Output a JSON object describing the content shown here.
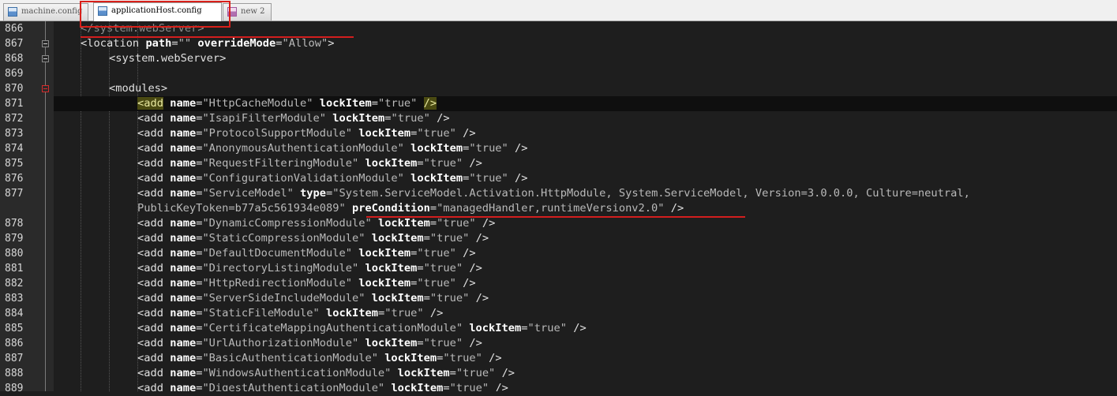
{
  "tabs": [
    {
      "label": "machine.config",
      "icon": "xml-file-icon"
    },
    {
      "label": "applicationHost.config",
      "icon": "xml-file-icon"
    },
    {
      "label": "new  2",
      "icon": "modified-file-icon"
    }
  ],
  "active_tab": "applicationHost.config",
  "current_line": 871,
  "colors": {
    "highlight_red": "#d31e1e",
    "editor_bg": "#1e1e1e"
  },
  "line_numbers": [
    "866",
    "867",
    "868",
    "869",
    "870",
    "871",
    "872",
    "873",
    "874",
    "875",
    "876",
    "877",
    "",
    "878",
    "879",
    "880",
    "881",
    "882",
    "883",
    "884",
    "885",
    "886",
    "887",
    "888",
    "889"
  ],
  "code": {
    "l866": "</system.webServer>",
    "l867": {
      "lt": "<",
      "tag": "location",
      "a1": "path",
      "v1": "\"\"",
      "a2": "overrideMode",
      "v2": "\"Allow\"",
      "gt": ">"
    },
    "l868": "<system.webServer>",
    "l870": "<modules>",
    "l871": {
      "tag": "<add",
      "a1": "name",
      "v1": "\"HttpCacheModule\"",
      "a2": "lockItem",
      "v2": "\"true\"",
      "close": "/>"
    },
    "adds": [
      {
        "name": "\"IsapiFilterModule\"",
        "lock": "\"true\""
      },
      {
        "name": "\"ProtocolSupportModule\"",
        "lock": "\"true\""
      },
      {
        "name": "\"AnonymousAuthenticationModule\"",
        "lock": "\"true\""
      },
      {
        "name": "\"RequestFilteringModule\"",
        "lock": "\"true\""
      },
      {
        "name": "\"ConfigurationValidationModule\"",
        "lock": "\"true\""
      }
    ],
    "l877": {
      "tag": "<add",
      "a1": "name",
      "v1": "\"ServiceModel\"",
      "a2": "type",
      "v2": "\"System.ServiceModel.Activation.HttpModule, System.ServiceModel, Version=3.0.0.0, Culture=neutral,",
      "v2b": "PublicKeyToken=b77a5c561934e089\"",
      "a3": "preCondition",
      "v3": "\"managedHandler,runtimeVersionv2.0\"",
      "close": "/>"
    },
    "adds2": [
      {
        "name": "\"DynamicCompressionModule\"",
        "lock": "\"true\""
      },
      {
        "name": "\"StaticCompressionModule\"",
        "lock": "\"true\""
      },
      {
        "name": "\"DefaultDocumentModule\"",
        "lock": "\"true\""
      },
      {
        "name": "\"DirectoryListingModule\"",
        "lock": "\"true\""
      },
      {
        "name": "\"HttpRedirectionModule\"",
        "lock": "\"true\""
      },
      {
        "name": "\"ServerSideIncludeModule\"",
        "lock": "\"true\""
      },
      {
        "name": "\"StaticFileModule\"",
        "lock": "\"true\""
      },
      {
        "name": "\"CertificateMappingAuthenticationModule\"",
        "lock": "\"true\""
      },
      {
        "name": "\"UrlAuthorizationModule\"",
        "lock": "\"true\""
      },
      {
        "name": "\"BasicAuthenticationModule\"",
        "lock": "\"true\""
      },
      {
        "name": "\"WindowsAuthenticationModule\"",
        "lock": "\"true\""
      },
      {
        "name": "\"DigestAuthenticationModule\"",
        "lock": "\"true\""
      }
    ],
    "add_tag": "<add",
    "name_attr": "name",
    "lock_attr": "lockItem",
    "eq": "=",
    "self_close": "/>"
  }
}
